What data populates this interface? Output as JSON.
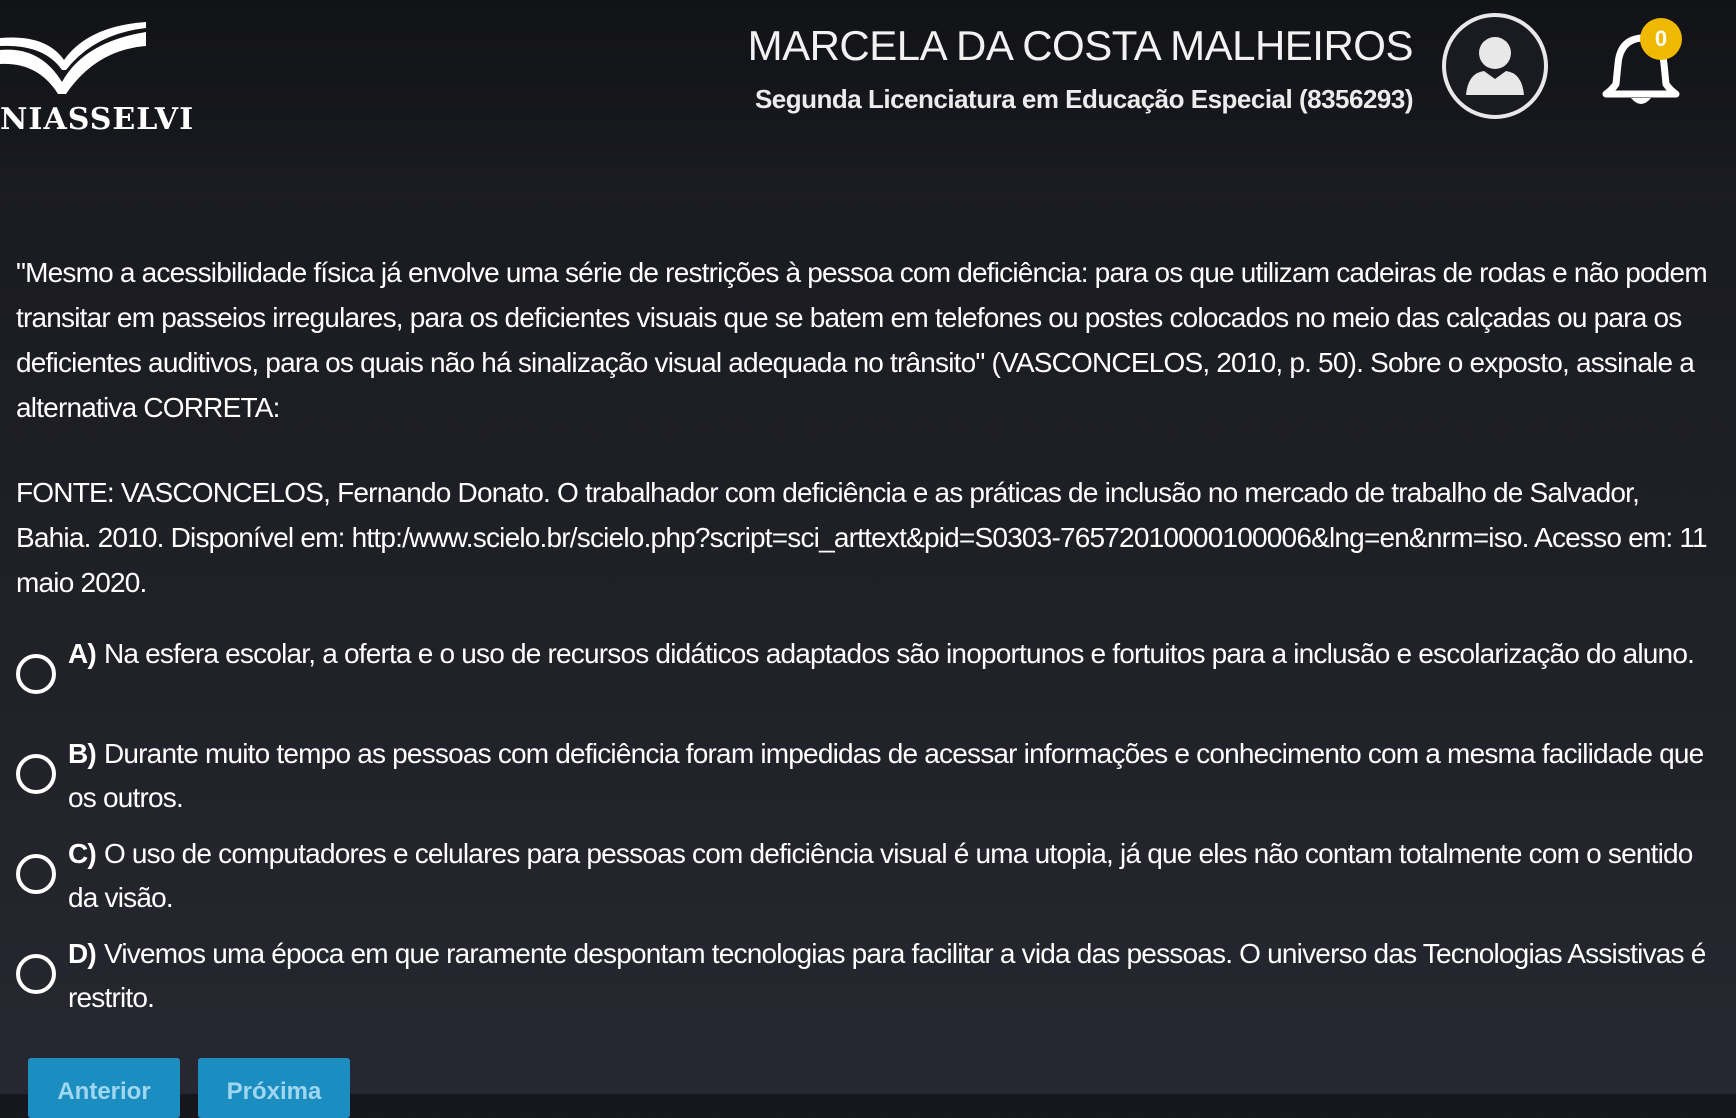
{
  "header": {
    "logo_text": "NIASSELVI",
    "user_name": "MARCELA DA COSTA MALHEIROS",
    "user_course": "Segunda Licenciatura em Educação Especial (8356293)",
    "notification_count": "0"
  },
  "question": {
    "text": "\"Mesmo a acessibilidade física já envolve uma série de restrições à pessoa com deficiência: para os que utilizam cadeiras de rodas e não podem transitar em passeios irregulares, para os deficientes visuais que se batem em telefones ou postes colocados no meio das calçadas ou para os deficientes auditivos, para os quais não há sinalização visual adequada no trânsito\" (VASCONCELOS, 2010, p. 50). Sobre o exposto, assinale a alternativa CORRETA:",
    "source": "FONTE: VASCONCELOS, Fernando Donato. O trabalhador com deficiência e as práticas de inclusão no mercado de trabalho de Salvador, Bahia. 2010. Disponível em: http:/www.scielo.br/scielo.php?script=sci_arttext&pid=S0303-76572010000100006&lng=en&nrm=iso. Acesso em: 11 maio 2020."
  },
  "options": [
    {
      "letter": "A)",
      "text": "Na esfera escolar, a oferta e o uso de recursos didáticos adaptados são inoportunos e fortuitos para a inclusão e escolarização do aluno."
    },
    {
      "letter": "B)",
      "text": "Durante muito tempo as pessoas com deficiência foram impedidas de acessar informações e conhecimento com a mesma facilidade que os outros."
    },
    {
      "letter": "C)",
      "text": "O uso de computadores e celulares para pessoas com deficiência visual é uma utopia, já que eles não contam totalmente com o sentido da visão."
    },
    {
      "letter": "D)",
      "text": "Vivemos uma época em que raramente despontam tecnologias para facilitar a vida das pessoas. O universo das Tecnologias Assistivas é restrito."
    }
  ],
  "nav": {
    "prev_label": "Anterior",
    "next_label": "Próxima"
  },
  "colors": {
    "background": "#1c1d23",
    "button": "#1b8dc0",
    "badge": "#f0b800",
    "text": "#ffffff"
  },
  "icons": {
    "logo": "book-wings-logo",
    "avatar": "user-silhouette-icon",
    "notifications": "bell-icon"
  }
}
